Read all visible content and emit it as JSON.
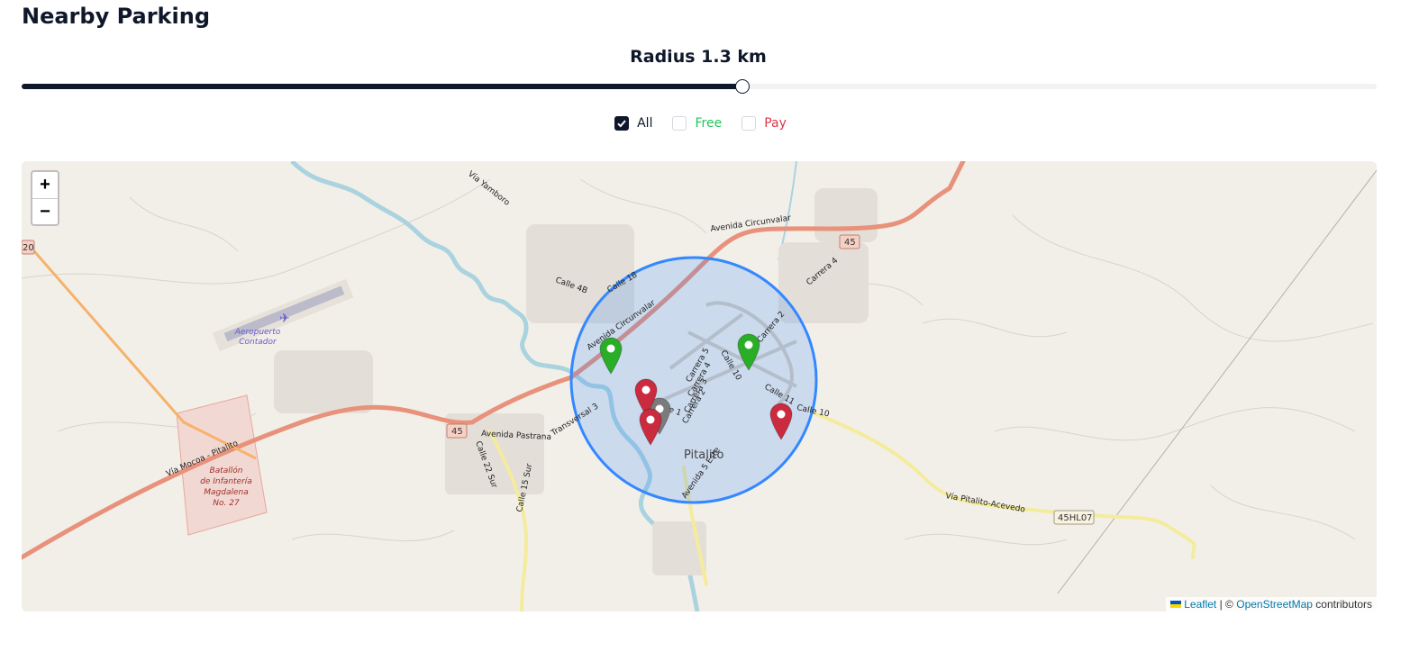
{
  "page": {
    "title": "Nearby Parking"
  },
  "radius": {
    "label": "Radius 1.3 km",
    "value_km": 1.3,
    "fraction": 0.532
  },
  "filters": [
    {
      "label": "All",
      "checked": true,
      "color": "#0f172a"
    },
    {
      "label": "Free",
      "checked": false,
      "color": "#22c55e"
    },
    {
      "label": "Pay",
      "checked": false,
      "color": "#dc3545"
    }
  ],
  "map": {
    "zoom_in": "+",
    "zoom_out": "−",
    "labels": {
      "airport": [
        "Aeropuerto",
        "Contador"
      ],
      "battalion": [
        "Batallón",
        "de Infantería",
        "Magdalena",
        "No. 27"
      ],
      "city": "Pitalito",
      "avenida_circunvalar_n": "Avenida Circunvalar",
      "avenida_circunvalar_w": "Avenida Circunvalar",
      "via_yamboro": "Vía Yamboro",
      "calle_4b": "Calle 4B",
      "calle_18": "Calle 18",
      "carrera_4": "Carrera 4",
      "carrera_2": "Carrera 2",
      "carrera_5": "Carrera 5",
      "carrera_4b": "Carrera 4",
      "carrera_3": "Carrera 3",
      "carrera_2b": "Carrera 2",
      "calle_10": "Calle 10",
      "calle_10b": "Calle 10",
      "calle_11": "Calle 11",
      "calle_1": "Calle 1",
      "avenida_pastrana": "Avenida Pastrana",
      "transversal_3": "Transversal 3",
      "calle_22_sur": "Calle 22 Sur",
      "calle_15_sur": "Calle 15 Sur",
      "avenida_5_este": "Avenida 5 Este",
      "via_mocoa": "Vía Mocoa - Pitalito",
      "via_acevedo": "Vía Pitalito-Acevedo",
      "shield_45_ne": "45",
      "shield_45_w": "45",
      "shield_20": "20",
      "shield_hl07": "45HL07"
    },
    "markers": [
      {
        "type": "free",
        "color": "#2aad27"
      },
      {
        "type": "free",
        "color": "#2aad27"
      },
      {
        "type": "pay",
        "color": "#cb2b3e"
      },
      {
        "type": "pay",
        "color": "#cb2b3e"
      },
      {
        "type": "pay",
        "color": "#cb2b3e"
      },
      {
        "type": "current",
        "color": "#7b7b7b"
      }
    ],
    "attribution": {
      "leaflet": "Leaflet",
      "separator": "| ©",
      "osm": "OpenStreetMap",
      "suffix": "contributors"
    }
  }
}
